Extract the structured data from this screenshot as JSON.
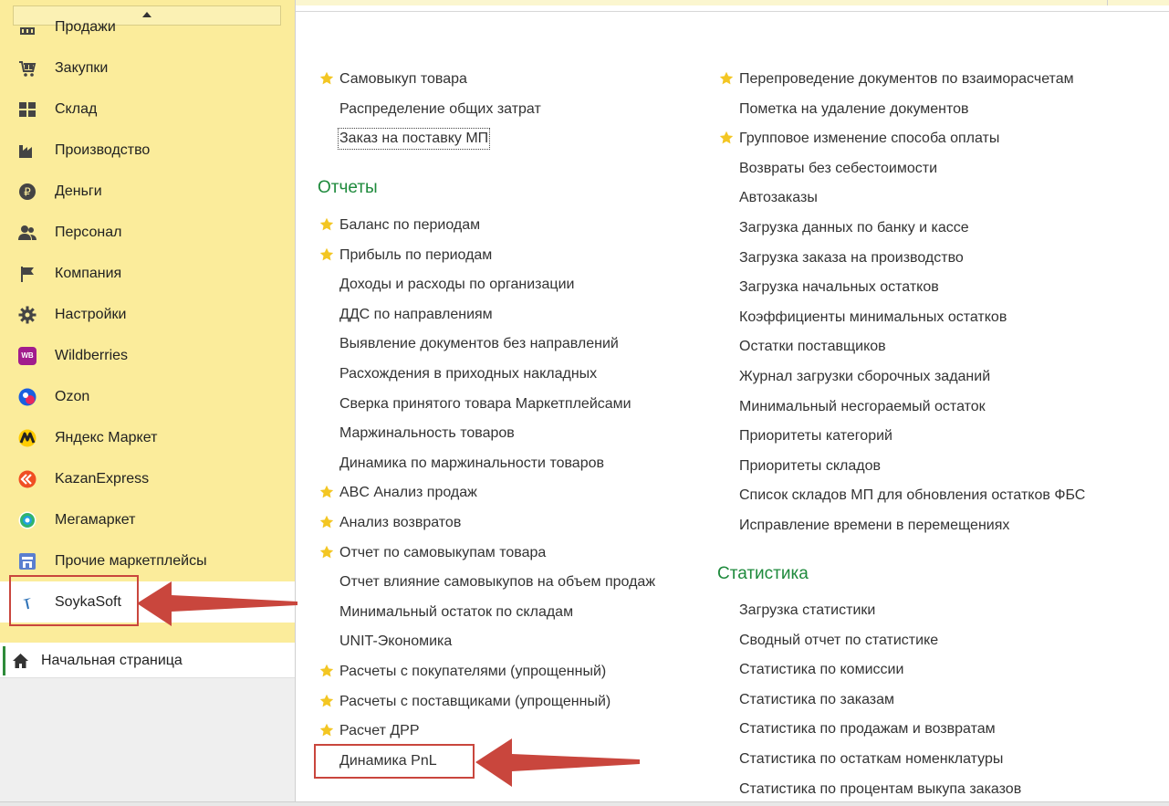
{
  "sidebar": {
    "items": [
      {
        "label": "Продажи",
        "icon": "sales-icon"
      },
      {
        "label": "Закупки",
        "icon": "purchases-icon"
      },
      {
        "label": "Склад",
        "icon": "warehouse-icon"
      },
      {
        "label": "Производство",
        "icon": "factory-icon"
      },
      {
        "label": "Деньги",
        "icon": "ruble-coin-icon"
      },
      {
        "label": "Персонал",
        "icon": "people-icon"
      },
      {
        "label": "Компания",
        "icon": "flag-icon"
      },
      {
        "label": "Настройки",
        "icon": "gear-icon"
      },
      {
        "label": "Wildberries",
        "icon": "wildberries-logo-icon"
      },
      {
        "label": "Ozon",
        "icon": "ozon-logo-icon"
      },
      {
        "label": "Яндекс Маркет",
        "icon": "yandex-market-logo-icon"
      },
      {
        "label": "KazanExpress",
        "icon": "kazanexpress-logo-icon"
      },
      {
        "label": "Мегамаркет",
        "icon": "megamarket-logo-icon"
      },
      {
        "label": "Прочие маркетплейсы",
        "icon": "store-icon"
      },
      {
        "label": "SoykaSoft",
        "icon": "soykasoft-logo-icon"
      }
    ],
    "wb_badge": "WB",
    "home": {
      "label": "Начальная страница",
      "icon": "home-icon"
    }
  },
  "left_column": {
    "top_links": [
      {
        "label": "Самовыкуп товара",
        "starred": true
      },
      {
        "label": "Распределение общих затрат",
        "starred": false
      },
      {
        "label": "Заказ на поставку МП",
        "starred": false
      }
    ],
    "reports_title": "Отчеты",
    "reports": [
      {
        "label": "Баланс по периодам",
        "starred": true
      },
      {
        "label": "Прибыль по периодам",
        "starred": true
      },
      {
        "label": "Доходы и расходы по организации",
        "starred": false
      },
      {
        "label": "ДДС по направлениям",
        "starred": false
      },
      {
        "label": "Выявление документов без направлений",
        "starred": false
      },
      {
        "label": "Расхождения в приходных накладных",
        "starred": false
      },
      {
        "label": "Сверка принятого товара Маркетплейсами",
        "starred": false
      },
      {
        "label": "Маржинальность товаров",
        "starred": false
      },
      {
        "label": "Динамика по маржинальности товаров",
        "starred": false
      },
      {
        "label": "ABC Анализ продаж",
        "starred": true
      },
      {
        "label": "Анализ возвратов",
        "starred": true
      },
      {
        "label": "Отчет по самовыкупам товара",
        "starred": true
      },
      {
        "label": "Отчет влияние самовыкупов на объем продаж",
        "starred": false
      },
      {
        "label": "Минимальный остаток по складам",
        "starred": false
      },
      {
        "label": "UNIT-Экономика",
        "starred": false
      },
      {
        "label": "Расчеты с покупателями (упрощенный)",
        "starred": true
      },
      {
        "label": "Расчеты с поставщиками (упрощенный)",
        "starred": true
      },
      {
        "label": "Расчет ДРР",
        "starred": true
      },
      {
        "label": "Динамика PnL",
        "starred": false
      }
    ]
  },
  "right_column": {
    "links": [
      {
        "label": "Перепроведение документов по взаиморасчетам",
        "starred": true
      },
      {
        "label": "Пометка на удаление документов",
        "starred": false
      },
      {
        "label": "Групповое изменение способа оплаты",
        "starred": true
      },
      {
        "label": "Возвраты без себестоимости",
        "starred": false
      },
      {
        "label": "Автозаказы",
        "starred": false
      },
      {
        "label": "Загрузка данных по банку и кассе",
        "starred": false
      },
      {
        "label": "Загрузка заказа на производство",
        "starred": false
      },
      {
        "label": "Загрузка начальных остатков",
        "starred": false
      },
      {
        "label": "Коэффициенты минимальных остатков",
        "starred": false
      },
      {
        "label": "Остатки поставщиков",
        "starred": false
      },
      {
        "label": "Журнал загрузки сборочных заданий",
        "starred": false
      },
      {
        "label": "Минимальный несгораемый остаток",
        "starred": false
      },
      {
        "label": "Приоритеты категорий",
        "starred": false
      },
      {
        "label": "Приоритеты складов",
        "starred": false
      },
      {
        "label": "Список складов МП для обновления остатков ФБС",
        "starred": false
      },
      {
        "label": "Исправление времени в перемещениях",
        "starred": false
      }
    ],
    "stats_title": "Статистика",
    "stats": [
      {
        "label": "Загрузка статистики",
        "starred": false
      },
      {
        "label": "Сводный отчет по статистике",
        "starred": false
      },
      {
        "label": "Статистика по комиссии",
        "starred": false
      },
      {
        "label": "Статистика по заказам",
        "starred": false
      },
      {
        "label": "Статистика по продажам и возвратам",
        "starred": false
      },
      {
        "label": "Статистика по остаткам номенклатуры",
        "starred": false
      },
      {
        "label": "Статистика по процентам выкупа заказов",
        "starred": false
      }
    ]
  },
  "colors": {
    "sidebar_bg": "#fbec9b",
    "section_title": "#1e8a3c",
    "star": "#f3c623",
    "annotation": "#c9463d"
  }
}
